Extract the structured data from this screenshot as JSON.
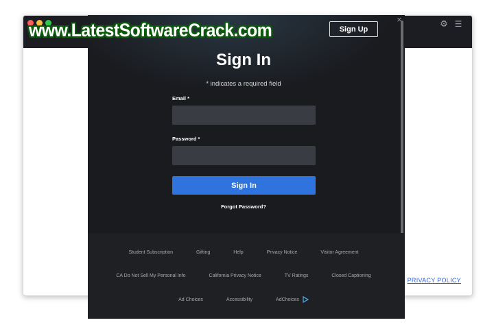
{
  "watermark": {
    "text": "www.LatestSoftwareCrack.com"
  },
  "app": {
    "privacy_link": "PRIVACY POLICY",
    "icons": {
      "settings": "gear-icon",
      "menu": "menu-icon",
      "privacy": "shield-icon"
    }
  },
  "modal": {
    "signup_label": "Sign Up",
    "title": "Sign In",
    "required_note": "* indicates a required field",
    "email_label": "Email *",
    "email_value": "",
    "password_label": "Password *",
    "password_value": "",
    "signin_label": "Sign In",
    "forgot_label": "Forgot Password?"
  },
  "footer": {
    "row1": [
      "Student Subscription",
      "Gifting",
      "Help",
      "Privacy Notice",
      "Visitor Agreement"
    ],
    "row2": [
      "CA Do Not Sell My Personal Info",
      "California Privacy Notice",
      "TV Ratings",
      "Closed Captioning"
    ],
    "row3": [
      "Ad Choices",
      "Accessibility",
      "AdChoices"
    ]
  },
  "colors": {
    "accent": "#2f73de",
    "modal_bg": "#1a1b1f",
    "input_bg": "#3a3c44",
    "link": "#2c5fd6"
  }
}
